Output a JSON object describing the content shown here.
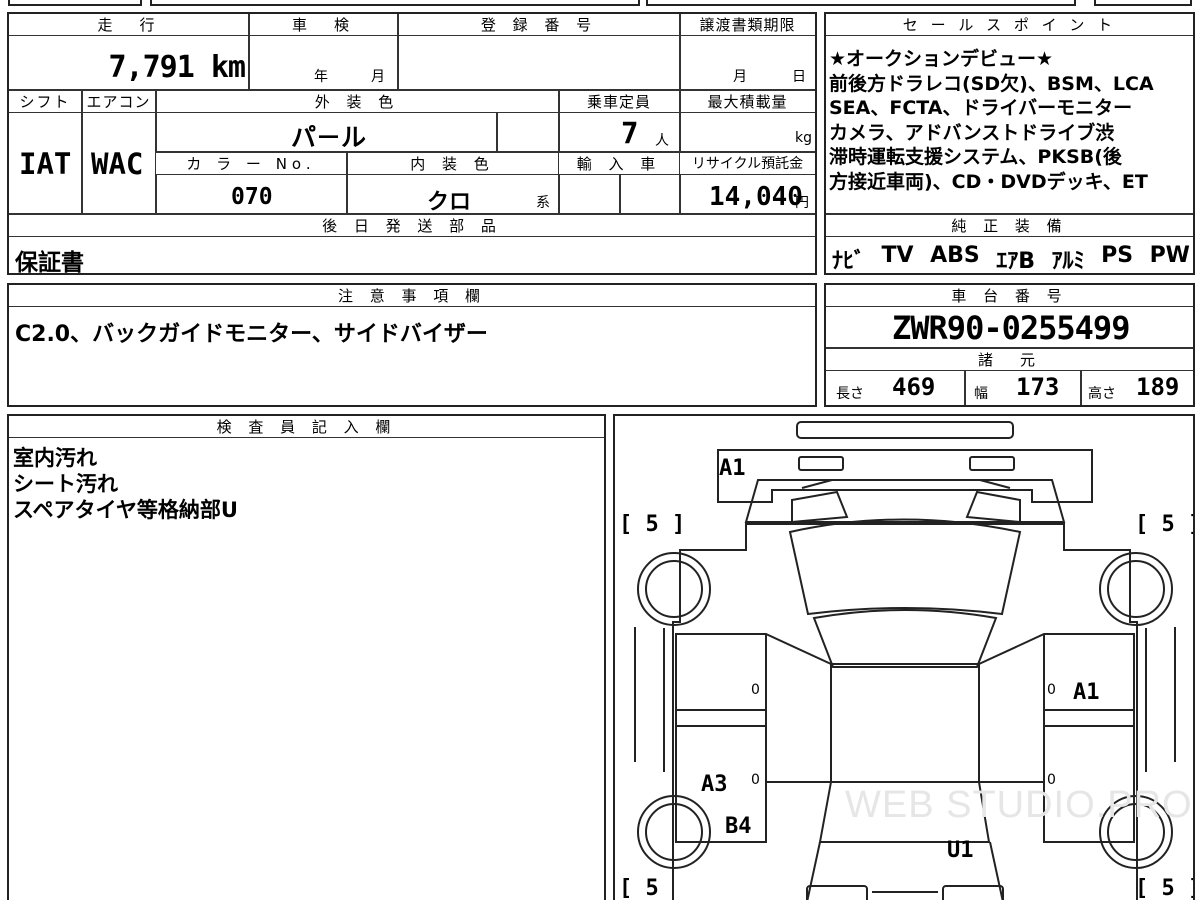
{
  "top_row": {
    "odometer_header": "走　行",
    "inspection_header": "車　検",
    "registration_header": "登 録 番 号",
    "transfer_header": "譲渡書類期限",
    "odometer_value": "7,791 km",
    "inspection_year": "年",
    "inspection_month": "月",
    "transfer_month": "月",
    "transfer_day": "日"
  },
  "spec_row": {
    "shift_header": "シフト",
    "ac_header": "エアコン",
    "exterior_header": "外 装 色",
    "capacity_header": "乗車定員",
    "max_load_header": "最大積載量",
    "shift_value": "IAT",
    "ac_value": "WAC",
    "exterior_value": "パ－ル",
    "capacity_value": "7",
    "capacity_unit": "人",
    "max_load_unit": "kg",
    "color_no_header": "カ ラ ー No.",
    "interior_header": "内 装 色",
    "import_header": "輸 入 車",
    "recycle_header": "リサイクル預託金",
    "color_no_value": "070",
    "interior_value": "クロ",
    "interior_suffix": "系",
    "recycle_value": "14,040",
    "recycle_unit": "円"
  },
  "parts": {
    "header": "後 日 発 送 部 品",
    "value": "保証書"
  },
  "sales_point": {
    "header": "セ ー ル ス ポ イ ン ト",
    "lines": [
      "★オークションデビュー★",
      "前後方ドラレコ(SD欠)、BSM、LCA",
      "SEA、FCTA、ドライバーモニター",
      "カメラ、アドバンストドライブ渋",
      "滞時運転支援システム、PKSB(後",
      "方接近車両)、CD・DVDデッキ、ET"
    ]
  },
  "equipment": {
    "header": "純 正 装 備",
    "items": [
      "ﾅﾋﾞ",
      "TV",
      "ABS",
      "ｴｱB",
      "ｱﾙﾐ",
      "PS",
      "PW"
    ]
  },
  "notes": {
    "header": "注 意 事 項 欄",
    "value": "C2.0、バックガイドモニター、サイドバイザー"
  },
  "chassis": {
    "header": "車 台 番 号",
    "value": "ZWR90-0255499",
    "dims_header": "諸　元",
    "length_label": "長さ",
    "length_value": "469",
    "width_label": "幅",
    "width_value": "173",
    "height_label": "高さ",
    "height_value": "189"
  },
  "inspector": {
    "header": "検 査 員 記 入 欄",
    "lines": [
      "室内汚れ",
      "シート汚れ",
      "スペアタイヤ等格納部U"
    ]
  },
  "diagram": {
    "tire_marks": [
      "[ 5 ]",
      "[ 5 ]",
      "[ 5",
      "[ 5 ]"
    ],
    "damage_codes": {
      "front": "A1",
      "right_front_door": "A1",
      "left_rear_door": "A3",
      "left_rear_quarter": "B4",
      "rear": "U1"
    },
    "zero_marks": [
      "0",
      "0",
      "0",
      "0"
    ],
    "watermark": "WEB STUDIO.PRO"
  }
}
